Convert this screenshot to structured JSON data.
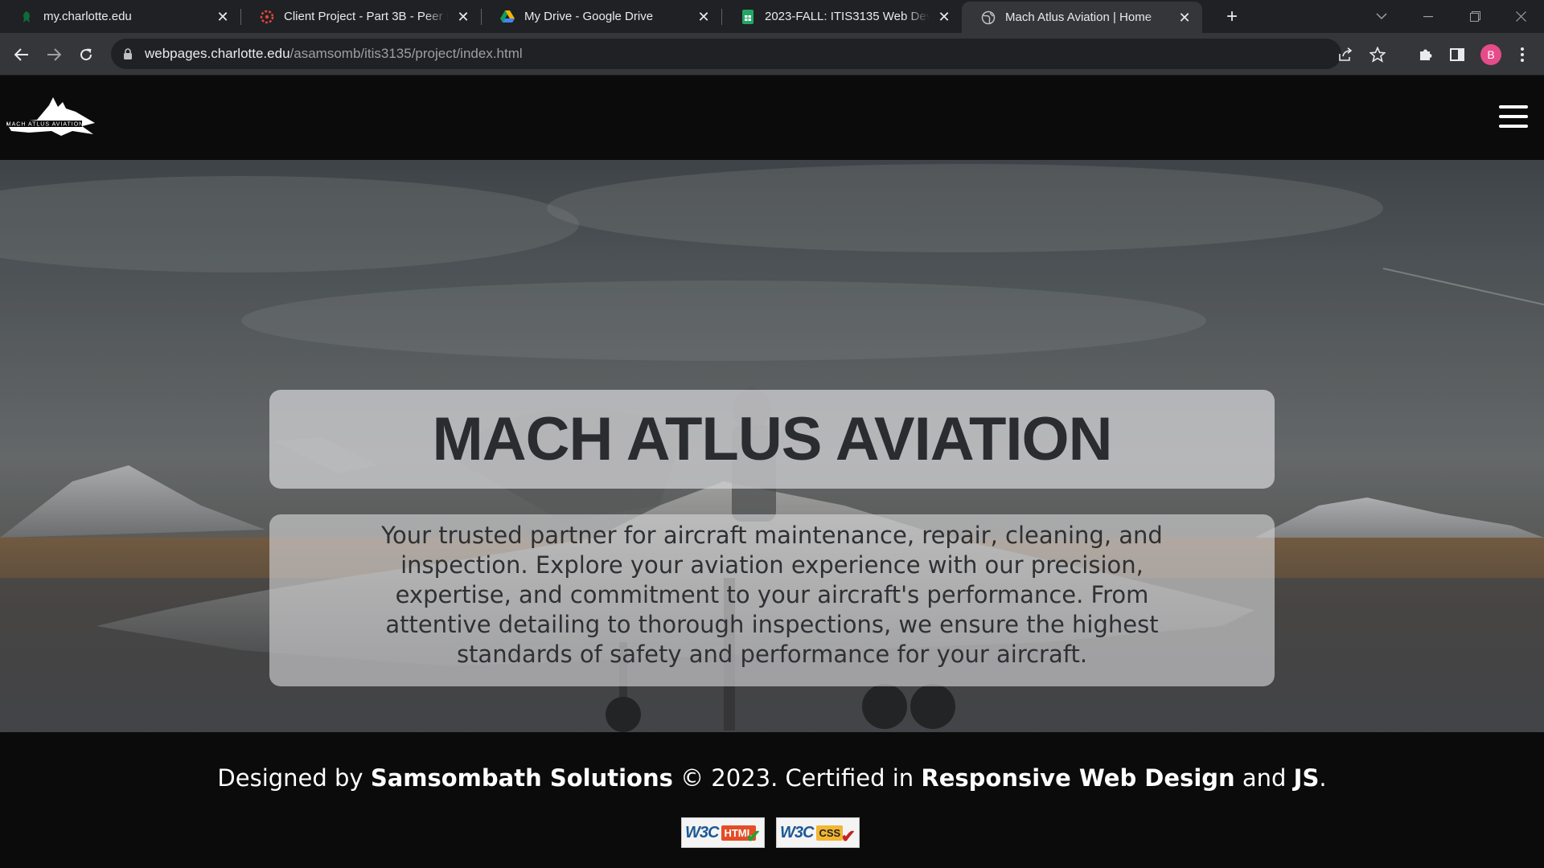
{
  "browser": {
    "tabs": [
      {
        "title": "my.charlotte.edu",
        "icon": "charlotte-favicon-icon",
        "active": false
      },
      {
        "title": "Client Project - Part 3B - Peer Evaluation",
        "icon": "canvas-favicon-icon",
        "active": false
      },
      {
        "title": "My Drive - Google Drive",
        "icon": "google-drive-icon",
        "active": false
      },
      {
        "title": "2023-FALL: ITIS3135 Web Development",
        "icon": "google-sheets-icon",
        "active": false
      },
      {
        "title": "Mach Atlus Aviation | Home",
        "icon": "globe-icon",
        "active": true
      }
    ],
    "url_host": "webpages.charlotte.edu",
    "url_path": "/asamsomb/itis3135/project/index.html",
    "profile_initial": "B",
    "colors": {
      "tab_strip": "#202124",
      "active_tab": "#35363a",
      "omnibox": "#202124",
      "avatar": "#e64b8a"
    }
  },
  "site": {
    "logo_alt": "Mach Atlus Aviation logo",
    "logo_text": "MACH ATLUS AVIATION",
    "hero": {
      "title": "MACH ATLUS AVIATION",
      "description": "Your trusted partner for aircraft maintenance, repair, cleaning, and inspection. Explore your aviation experience with our precision, expertise, and commitment to your aircraft's performance. From attentive detailing to thorough inspections, we ensure the highest standards of safety and performance for your aircraft."
    },
    "footer": {
      "prefix": "Designed by ",
      "company": "Samsombath Solutions",
      "middle": " © 2023. Certified in ",
      "cert1": "Responsive Web Design",
      "joiner": " and ",
      "cert2": "JS",
      "suffix": ".",
      "badges": [
        {
          "logo": "W3C",
          "label": "HTML"
        },
        {
          "logo": "W3C",
          "label": "CSS"
        }
      ]
    },
    "colors": {
      "header_bg": "#0b0b0b",
      "title_text": "#2a2c30",
      "panel_bg": "rgba(210,210,212,0.7)",
      "footer_text": "#ffffff"
    }
  }
}
